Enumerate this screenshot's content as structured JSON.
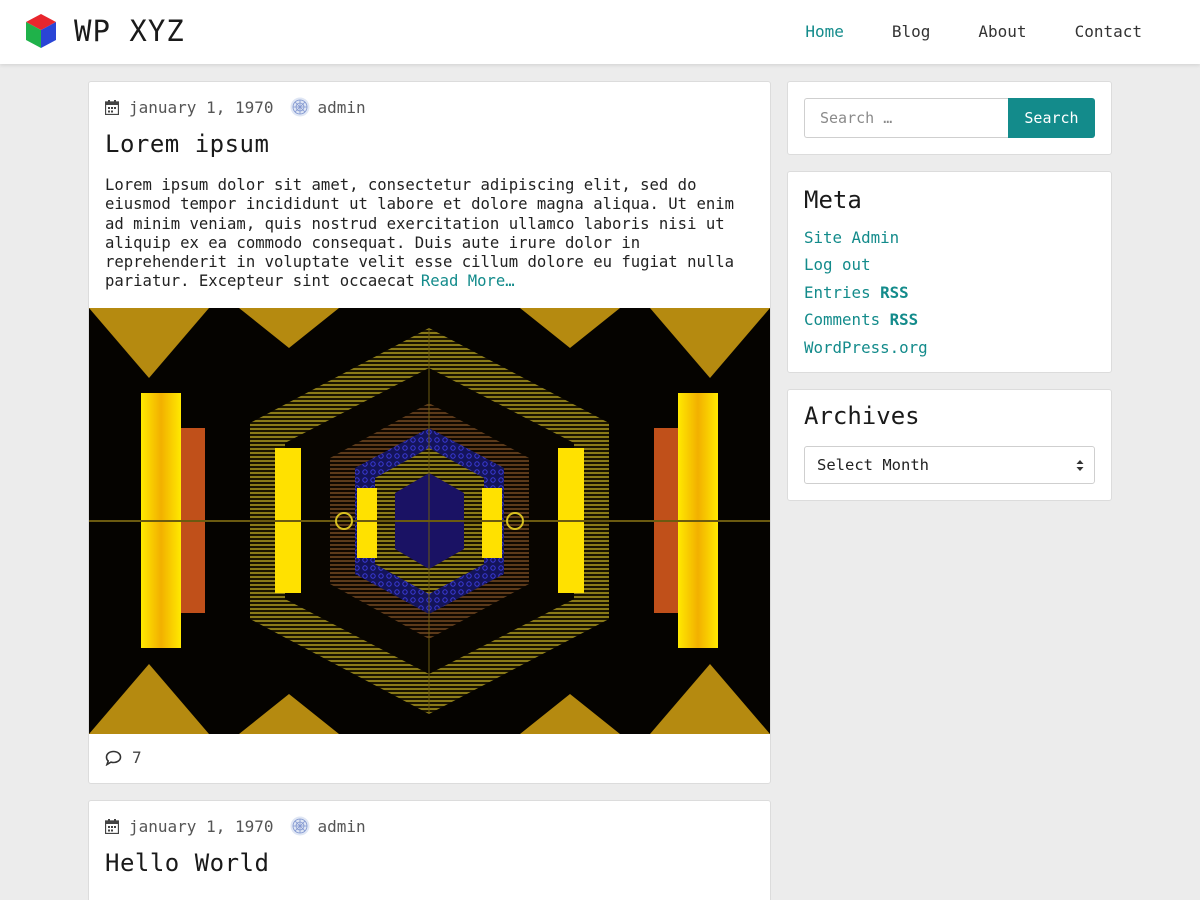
{
  "site": {
    "title": "WP XYZ",
    "logo_icon": "rgb-cube-icon"
  },
  "nav": {
    "items": [
      {
        "label": "Home",
        "active": true
      },
      {
        "label": "Blog",
        "active": false
      },
      {
        "label": "About",
        "active": false
      },
      {
        "label": "Contact",
        "active": false
      }
    ]
  },
  "posts": [
    {
      "date": "january 1, 1970",
      "author": "admin",
      "title": "Lorem ipsum",
      "excerpt": "Lorem ipsum dolor sit amet, consectetur adipiscing elit, sed do eiusmod tempor incididunt ut labore et dolore magna aliqua. Ut enim ad minim veniam, quis nostrud exercitation ullamco laboris nisi ut aliquip ex ea commodo consequat. Duis aute irure dolor in reprehenderit in voluptate velit esse cillum dolore eu fugiat nulla pariatur. Excepteur sint occaecat",
      "read_more": "Read More…",
      "comments": "7",
      "featured_image": "kaleidoscope-featured-image"
    },
    {
      "date": "january 1, 1970",
      "author": "admin",
      "title": "Hello World"
    }
  ],
  "sidebar": {
    "search": {
      "placeholder": "Search …",
      "button_label": "Search"
    },
    "meta": {
      "title": "Meta",
      "links": {
        "site_admin": "Site Admin",
        "log_out": "Log out",
        "entries": "Entries",
        "comments": "Comments",
        "rss": "RSS",
        "wordpress": "WordPress.org"
      }
    },
    "archives": {
      "title": "Archives",
      "select_value": "Select Month"
    }
  },
  "colors": {
    "accent": "#138b8b",
    "background": "#ececec"
  }
}
